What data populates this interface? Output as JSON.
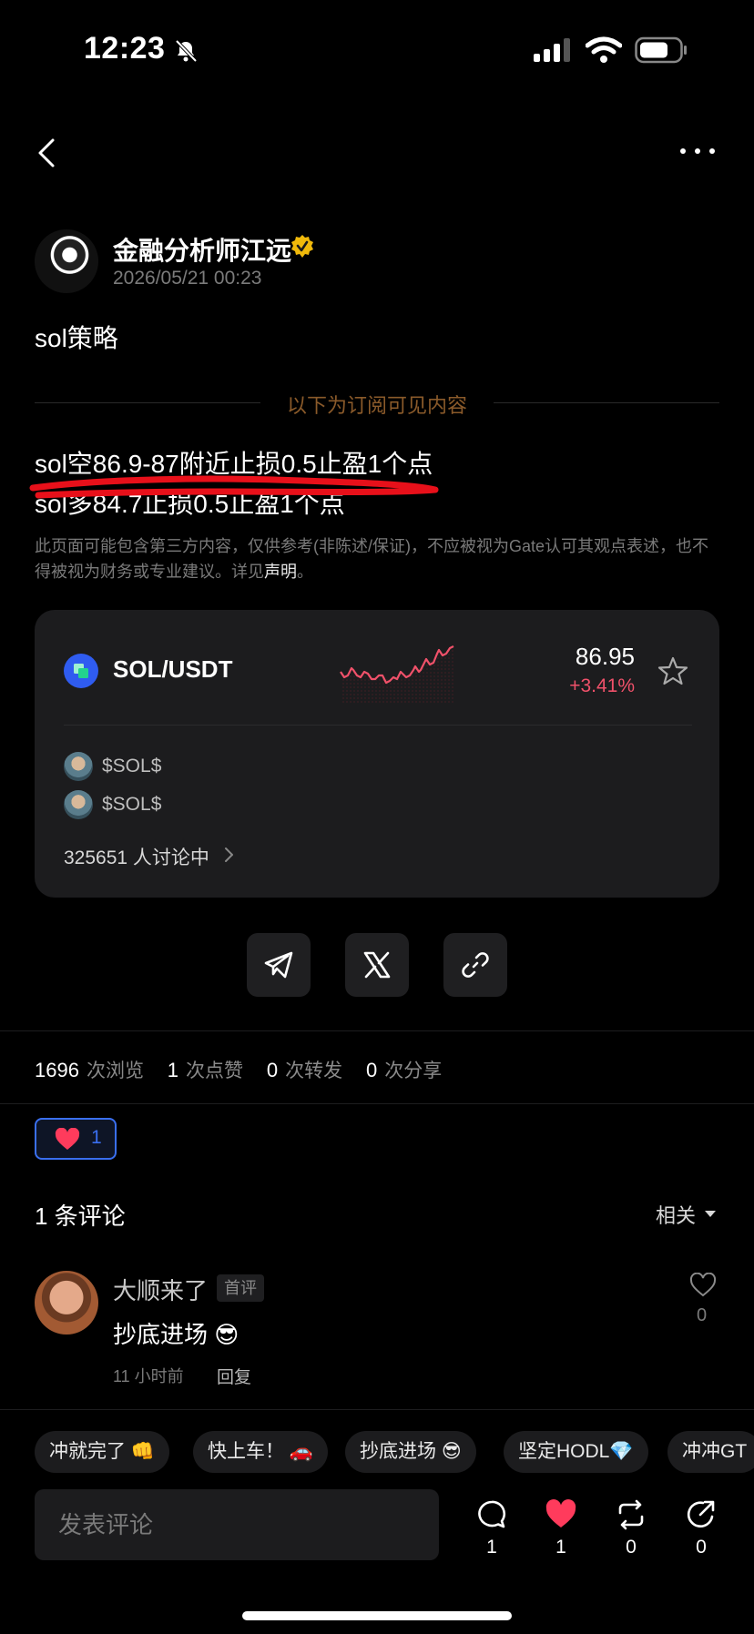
{
  "status_bar": {
    "time": "12:23"
  },
  "author": {
    "name": "金融分析师江远",
    "time": "2026/05/21 00:23"
  },
  "post": {
    "title": "sol策略",
    "subscription_notice": "以下为订阅可见内容",
    "lines": [
      "sol空86.9-87附近止损0.5止盈1个点",
      "sol多84.7止损0.5止盈1个点"
    ],
    "disclaimer_text": "此页面可能包含第三方内容，仅供参考(非陈述/保证)，不应被视为Gate认可其观点表述，也不得被视为财务或专业建议。详见",
    "disclaimer_link": "声明",
    "disclaimer_end": "。"
  },
  "market_card": {
    "pair": "SOL/USDT",
    "price": "86.95",
    "change": "+3.41%",
    "change_color": "#f0516a",
    "tags": [
      "$SOL$",
      "$SOL$"
    ],
    "discussing": "325651 人讨论中"
  },
  "share_icons": [
    "telegram-icon",
    "x-icon",
    "link-icon"
  ],
  "stats": {
    "views": "1696",
    "views_label": "次浏览",
    "likes": "1",
    "likes_label": "次点赞",
    "reposts": "0",
    "reposts_label": "次转发",
    "shares": "0",
    "shares_label": "次分享"
  },
  "reaction": {
    "count": "1"
  },
  "comments": {
    "title": "1 条评论",
    "sort": "相关",
    "items": [
      {
        "name": "大顺来了",
        "badge": "首评",
        "text": "抄底进场 😎",
        "time": "11 小时前",
        "reply": "回复",
        "likes": "0"
      }
    ]
  },
  "quick_replies": [
    "冲就完了 👊",
    "快上车！ 🚗",
    "抄底进场 😎",
    "坚定HODL💎",
    "冲冲GT"
  ],
  "bottom_bar": {
    "placeholder": "发表评论",
    "comment_count": "1",
    "like_count": "1",
    "repost_count": "0",
    "share_count": "0"
  },
  "colors": {
    "accent_blue": "#3a6ff0",
    "like_red": "#ff3b5c",
    "down_red": "#f0516a"
  }
}
